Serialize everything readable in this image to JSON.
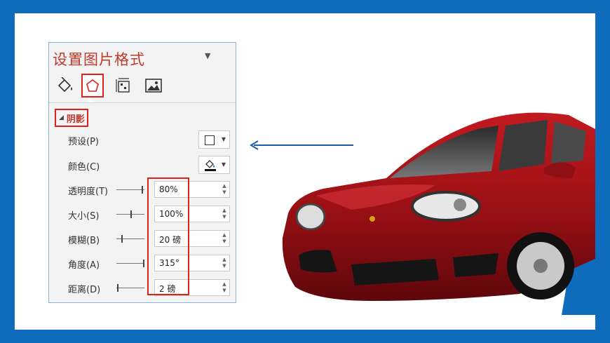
{
  "pane": {
    "title": "设置图片格式",
    "menu_caret": "▼",
    "tabs": [
      {
        "icon": "fill-bucket-icon"
      },
      {
        "icon": "pentagon-effects-icon",
        "active": true
      },
      {
        "icon": "size-properties-icon"
      },
      {
        "icon": "picture-icon"
      }
    ],
    "section": {
      "toggle": "◢",
      "label": "阴影"
    },
    "rows": [
      {
        "label": "预设(P)",
        "type": "dropdown"
      },
      {
        "label": "颜色(C)",
        "type": "dropdown"
      },
      {
        "label": "透明度(T)",
        "type": "spin",
        "value": "80%",
        "slider": 0.8
      },
      {
        "label": "大小(S)",
        "type": "spin",
        "value": "100%",
        "slider": 0.5
      },
      {
        "label": "模糊(B)",
        "type": "spin",
        "value": "20 磅",
        "slider": 0.2
      },
      {
        "label": "角度(A)",
        "type": "spin",
        "value": "315°",
        "slider": 0.9
      },
      {
        "label": "距离(D)",
        "type": "spin",
        "value": "2 磅",
        "slider": 0.05
      }
    ],
    "spin_up": "▲",
    "spin_down": "▼"
  },
  "colors": {
    "accent_red": "#e0201b",
    "title_red": "#c0392b",
    "frame_blue": "#0f6cbd",
    "car_red": "#9b1015"
  }
}
